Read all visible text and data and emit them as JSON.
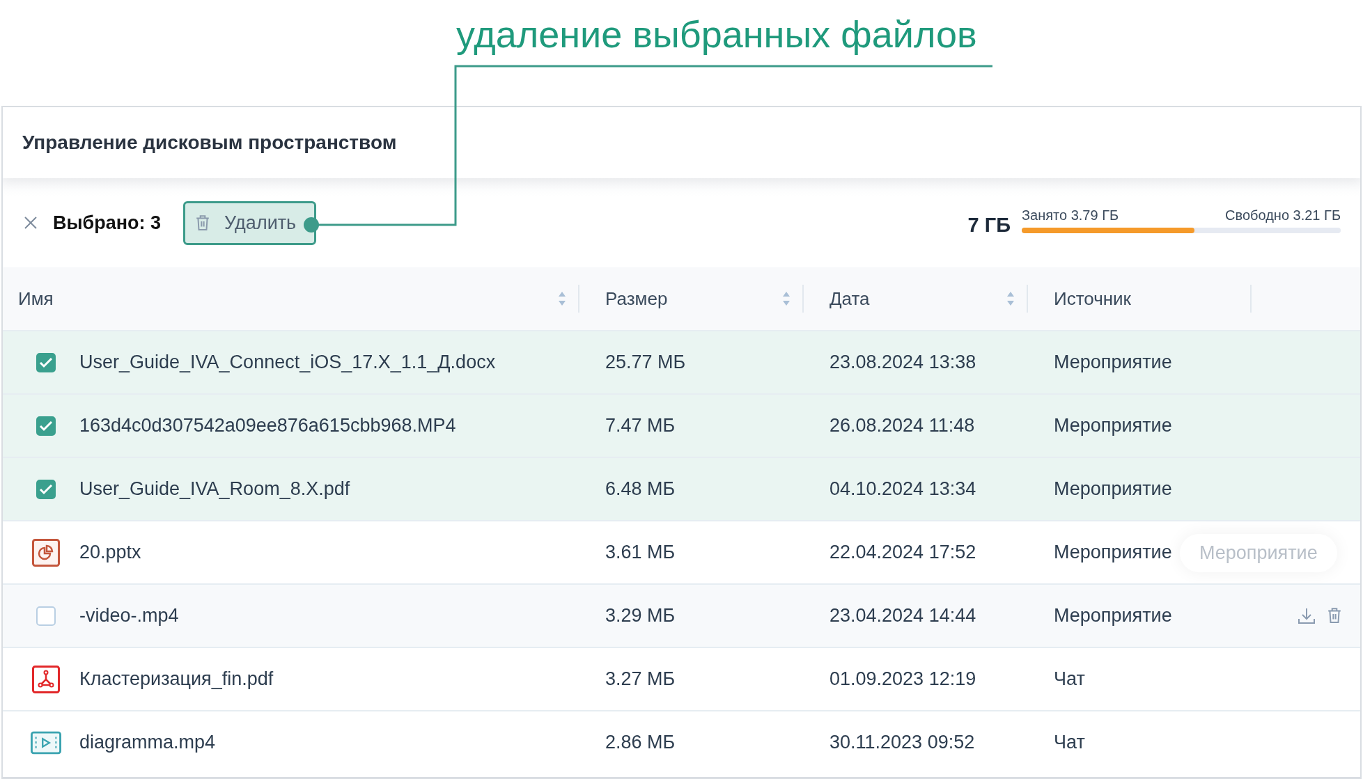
{
  "callout": {
    "text": "удаление выбранных файлов"
  },
  "panel": {
    "title": "Управление дисковым пространством"
  },
  "toolbar": {
    "selected_label": "Выбрано: 3",
    "delete_button": "Удалить"
  },
  "storage": {
    "total": "7 ГБ",
    "used": "Занято 3.79 ГБ",
    "free": "Свободно 3.21 ГБ",
    "level": 0.541
  },
  "table": {
    "columns": [
      {
        "label": "Имя",
        "sortable": true
      },
      {
        "label": "Размер",
        "sortable": true
      },
      {
        "label": "Дата",
        "sortable": true
      },
      {
        "label": "Источник",
        "sortable": false
      }
    ],
    "rows": [
      {
        "kind": "checkbox",
        "selected": true,
        "hovered": false,
        "name": "User_Guide_IVA_Connect_iOS_17.X_1.1_Д.docx",
        "size": "25.77 МБ",
        "date": "23.08.2024 13:38",
        "source": "Мероприятие"
      },
      {
        "kind": "checkbox",
        "selected": true,
        "hovered": false,
        "name": "163d4c0d307542a09ee876a615cbb968.MP4",
        "size": "7.47 МБ",
        "date": "26.08.2024 11:48",
        "source": "Мероприятие"
      },
      {
        "kind": "checkbox",
        "selected": true,
        "hovered": false,
        "name": "User_Guide_IVA_Room_8.X.pdf",
        "size": "6.48 МБ",
        "date": "04.10.2024 13:34",
        "source": "Мероприятие"
      },
      {
        "kind": "presentation",
        "selected": false,
        "hovered": false,
        "name": "20.pptx",
        "size": "3.61 МБ",
        "date": "22.04.2024 17:52",
        "source": "Мероприятие",
        "tooltip": "Мероприятие"
      },
      {
        "kind": "checkbox",
        "selected": false,
        "hovered": true,
        "name": "-video-.mp4",
        "size": "3.29 МБ",
        "date": "23.04.2024 14:44",
        "source": "Мероприятие"
      },
      {
        "kind": "pdf",
        "selected": false,
        "hovered": false,
        "name": "Кластеризация_fin.pdf",
        "size": "3.27 МБ",
        "date": "01.09.2023 12:19",
        "source": "Чат"
      },
      {
        "kind": "video",
        "selected": false,
        "hovered": false,
        "name": "diagramma.mp4",
        "size": "2.86 МБ",
        "date": "30.11.2023 09:52",
        "source": "Чат"
      }
    ]
  }
}
